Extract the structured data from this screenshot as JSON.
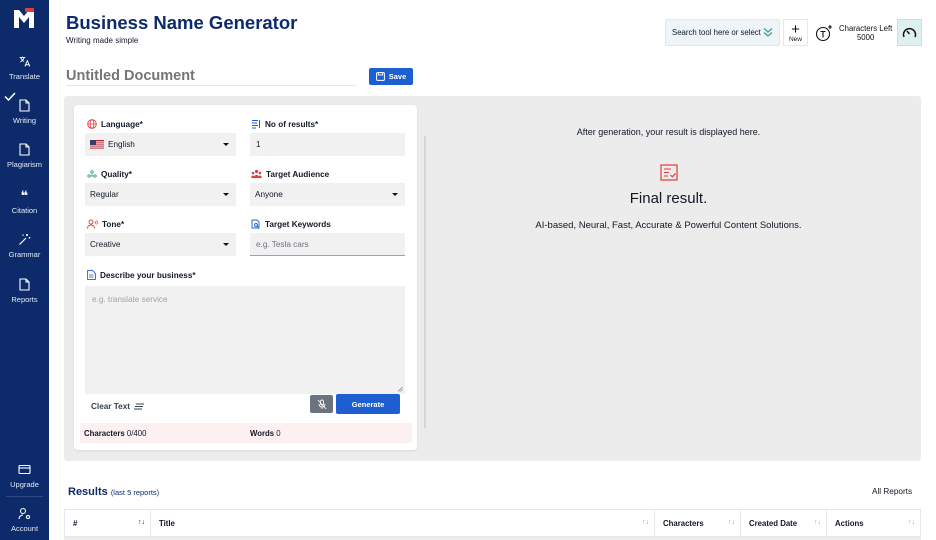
{
  "app": {
    "title": "Business Name Generator",
    "subtitle": "Writing made simple"
  },
  "sidebar": {
    "items": [
      {
        "label": "Translate",
        "icon": "translate-icon"
      },
      {
        "label": "Writing",
        "icon": "document-icon"
      },
      {
        "label": "Plagiarism",
        "icon": "document-icon"
      },
      {
        "label": "Citation",
        "icon": "quote-icon"
      },
      {
        "label": "Grammar",
        "icon": "magic-wand-icon"
      },
      {
        "label": "Reports",
        "icon": "document-icon"
      },
      {
        "label": "Upgrade",
        "icon": "card-icon"
      },
      {
        "label": "Account",
        "icon": "account-icon"
      }
    ]
  },
  "header": {
    "search_placeholder": "Search tool here or select",
    "new_label": "New",
    "chars_left_label": "Characters Left",
    "chars_left_value": "5000"
  },
  "document": {
    "title_placeholder": "Untitled Document",
    "save_label": "Save"
  },
  "form": {
    "language": {
      "label": "Language*",
      "value": "English"
    },
    "results": {
      "label": "No of results*",
      "value": "1"
    },
    "quality": {
      "label": "Quality*",
      "value": "Regular"
    },
    "audience": {
      "label": "Target Audience",
      "value": "Anyone"
    },
    "tone": {
      "label": "Tone*",
      "value": "Creative"
    },
    "keywords": {
      "label": "Target Keywords",
      "placeholder": "e.g. Tesla cars"
    },
    "describe": {
      "label": "Describe your business*",
      "placeholder": "e.g. translate service"
    },
    "clear_label": "Clear Text",
    "generate_label": "Generate",
    "characters_label": "Characters",
    "characters_value": "0/400",
    "words_label": "Words",
    "words_value": "0"
  },
  "result": {
    "info": "After generation, your result is displayed here.",
    "final": "Final result.",
    "tagline": "AI-based, Neural, Fast, Accurate & Powerful Content Solutions."
  },
  "results_section": {
    "title": "Results",
    "subtitle": "(last 5 reports)",
    "all_reports": "All Reports",
    "columns": [
      "#",
      "Title",
      "Characters",
      "Created Date",
      "Actions"
    ]
  },
  "colors": {
    "sidebar": "#0d2a6b",
    "primary": "#1d5fd1",
    "accent_icon": "#e23b3b"
  }
}
